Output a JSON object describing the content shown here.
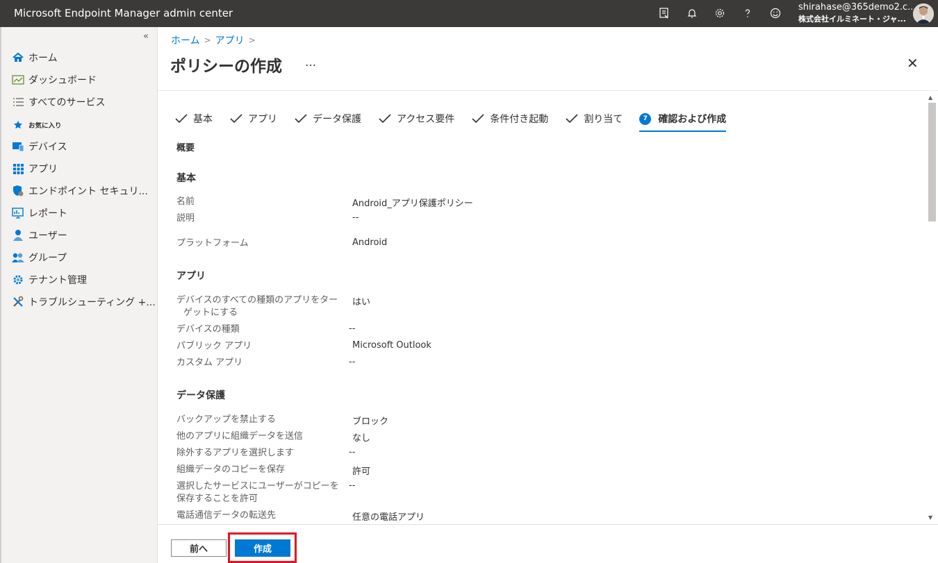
{
  "app": {
    "title": "Microsoft Endpoint Manager admin center",
    "user_email": "shirahase@365demo2.c...",
    "user_org": "株式会社イルミネート・ジャ..."
  },
  "topbar_icons": [
    "portal-feedback-icon",
    "bell-icon",
    "gear-icon",
    "help-icon",
    "smiley-icon"
  ],
  "sidebar": {
    "collapse": "«",
    "favorites_label": "お気に入り",
    "items": [
      {
        "label": "ホーム",
        "icon": "home-icon"
      },
      {
        "label": "ダッシュボード",
        "icon": "dashboard-icon"
      },
      {
        "label": "すべてのサービス",
        "icon": "list-icon"
      },
      {
        "label": "デバイス",
        "icon": "devices-icon"
      },
      {
        "label": "アプリ",
        "icon": "apps-icon"
      },
      {
        "label": "エンドポイント セキュリ...",
        "icon": "shield-icon"
      },
      {
        "label": "レポート",
        "icon": "reports-icon"
      },
      {
        "label": "ユーザー",
        "icon": "user-icon"
      },
      {
        "label": "グループ",
        "icon": "group-icon"
      },
      {
        "label": "テナント管理",
        "icon": "tenant-icon"
      },
      {
        "label": "トラブルシューティング +...",
        "icon": "tools-icon"
      }
    ]
  },
  "breadcrumb": [
    "ホーム",
    "アプリ"
  ],
  "page": {
    "title": "ポリシーの作成",
    "more": "…",
    "close": "✕"
  },
  "steps": [
    {
      "label": "基本",
      "done": true
    },
    {
      "label": "アプリ",
      "done": true
    },
    {
      "label": "データ保護",
      "done": true
    },
    {
      "label": "アクセス要件",
      "done": true
    },
    {
      "label": "条件付き起動",
      "done": true
    },
    {
      "label": "割り当て",
      "done": true
    },
    {
      "label": "確認および作成",
      "number": "7",
      "active": true
    }
  ],
  "summary": {
    "overview": "概要",
    "basics": {
      "heading": "基本",
      "rows": [
        {
          "label": "名前",
          "value": "Android_アプリ保護ポリシー"
        },
        {
          "label": "説明",
          "value": "--"
        },
        {
          "label": "プラットフォーム",
          "value": "Android"
        }
      ]
    },
    "apps": {
      "heading": "アプリ",
      "rows": [
        {
          "label": "デバイスのすべての種類のアプリをター",
          "label2": "ゲットにする",
          "value": "はい"
        },
        {
          "label": "デバイスの種類",
          "value": "--"
        },
        {
          "label": "パブリック アプリ",
          "value": "Microsoft Outlook"
        },
        {
          "label": "カスタム アプリ",
          "value": "--"
        }
      ]
    },
    "data_protection": {
      "heading": "データ保護",
      "rows": [
        {
          "label": "バックアップを禁止する",
          "value": "ブロック"
        },
        {
          "label": "他のアプリに組織データを送信",
          "value": "なし"
        },
        {
          "label": "除外するアプリを選択します",
          "value": "--"
        },
        {
          "label": "組織データのコピーを保存",
          "value": "許可"
        },
        {
          "label": "選択したサービスにユーザーがコピーを",
          "label2": "保存することを許可",
          "value": "--"
        },
        {
          "label": "電話通信データの転送先",
          "value": "任意の電話アプリ"
        }
      ]
    }
  },
  "footer": {
    "prev": "前へ",
    "create": "作成"
  },
  "colors": {
    "accent": "#0078d4",
    "topbar": "#3b3a39",
    "highlight": "#e81123"
  }
}
